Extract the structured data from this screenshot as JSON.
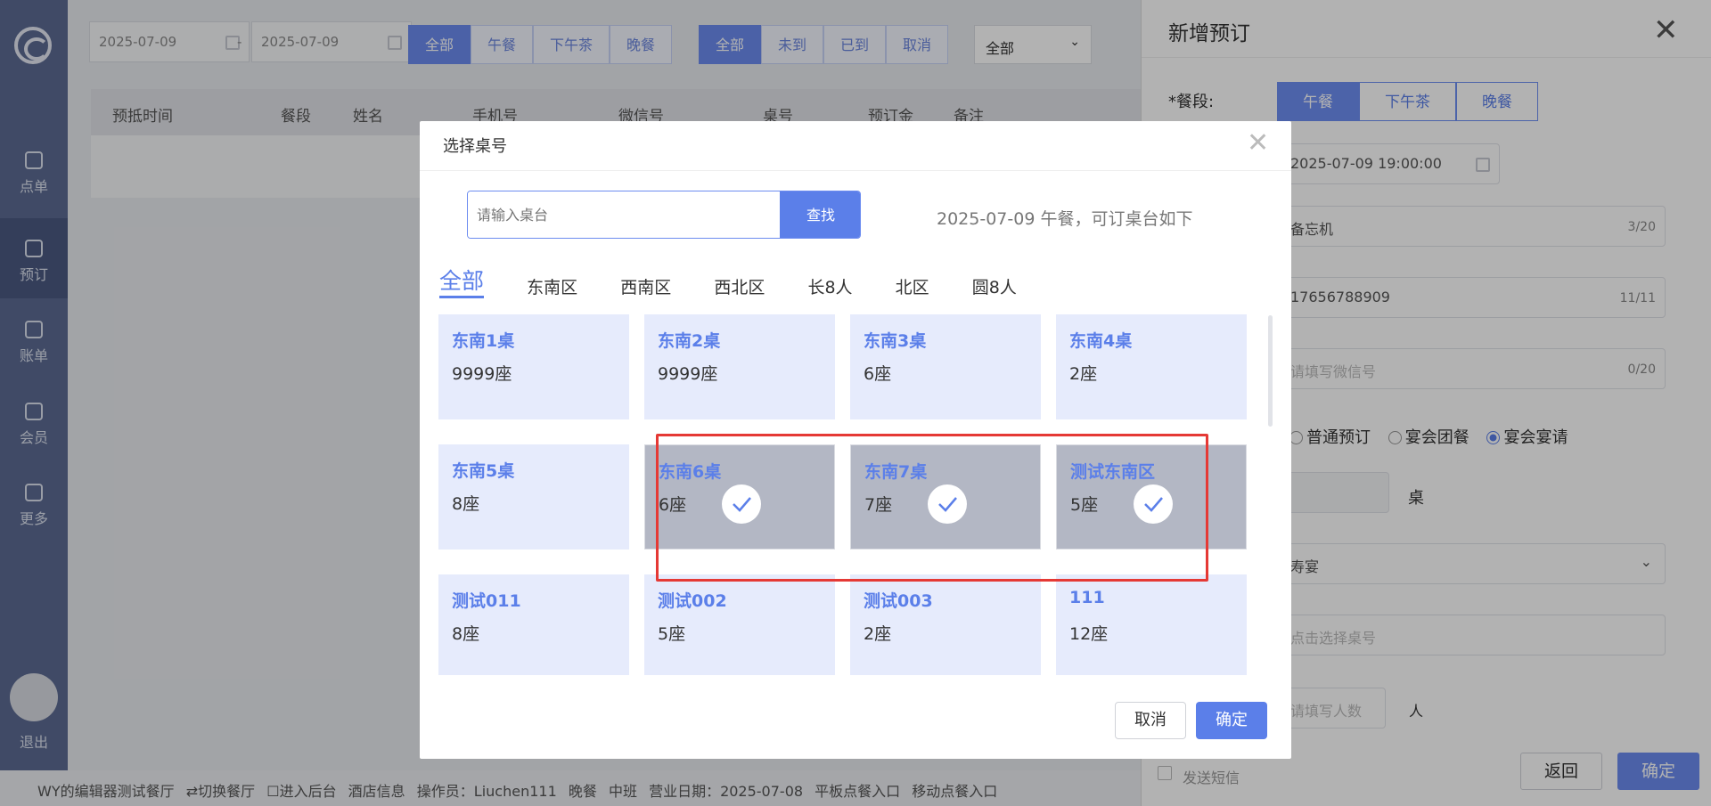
{
  "sidebar": {
    "items": [
      {
        "label": "点单",
        "icon": "chef-hat-icon"
      },
      {
        "label": "预订",
        "icon": "book-icon"
      },
      {
        "label": "账单",
        "icon": "chart-icon"
      },
      {
        "label": "会员",
        "icon": "diamond-icon"
      },
      {
        "label": "更多",
        "icon": "grid-icon"
      }
    ],
    "logout": "退出"
  },
  "filters": {
    "date_start": "2025-07-09",
    "date_sep": "-",
    "date_end": "2025-07-09",
    "meal_segments": [
      "全部",
      "午餐",
      "下午茶",
      "晚餐"
    ],
    "status_segments": [
      "全部",
      "未到",
      "已到",
      "取消"
    ],
    "select_value": "全部"
  },
  "table": {
    "columns": [
      "预抵时间",
      "餐段",
      "姓名",
      "手机号",
      "微信号",
      "桌号",
      "预订金",
      "备注"
    ]
  },
  "footer": {
    "items": [
      "WY的编辑器测试餐厅",
      "⇄切换餐厅",
      "☐进入后台",
      "酒店信息",
      "操作员：Liuchen111",
      "晚餐",
      "中班",
      "营业日期：2025-07-08",
      "平板点餐入口",
      "移动点餐入口"
    ]
  },
  "drawer": {
    "title": "新增预订",
    "close": "✕",
    "meal_label": "*餐段:",
    "meal_options": [
      "午餐",
      "下午茶",
      "晚餐"
    ],
    "datetime": "2025-07-09 19:00:00",
    "name_value": "备忘机",
    "name_count": "3/20",
    "phone_value": "17656788909",
    "phone_count": "11/11",
    "wechat_placeholder": "请填写微信号",
    "wechat_count": "0/20",
    "radio_options": [
      "普通预订",
      "宴会团餐",
      "宴会宴请"
    ],
    "tables_unit": "桌",
    "banquet_type": "寿宴",
    "table_placeholder": "点击选择桌号",
    "people_placeholder": "请填写人数",
    "people_unit": "人",
    "sms_label": "发送短信",
    "return_btn": "返回",
    "confirm_btn": "确定"
  },
  "modal": {
    "title": "选择桌号",
    "close": "✕",
    "search_placeholder": "请输入桌台",
    "search_btn": "查找",
    "avail_text": "2025-07-09  午餐，可订桌台如下",
    "tabs": [
      "全部",
      "东南区",
      "西南区",
      "西北区",
      "长8人",
      "北区",
      "圆8人"
    ],
    "cards": [
      {
        "name": "东南1桌",
        "seats": "9999座",
        "selected": false
      },
      {
        "name": "东南2桌",
        "seats": "9999座",
        "selected": false
      },
      {
        "name": "东南3桌",
        "seats": "6座",
        "selected": false
      },
      {
        "name": "东南4桌",
        "seats": "2座",
        "selected": false
      },
      {
        "name": "东南5桌",
        "seats": "8座",
        "selected": false
      },
      {
        "name": "东南6桌",
        "seats": "6座",
        "selected": true
      },
      {
        "name": "东南7桌",
        "seats": "7座",
        "selected": true
      },
      {
        "name": "测试东南区",
        "seats": "5座",
        "selected": true
      },
      {
        "name": "测试011",
        "seats": "8座",
        "selected": false
      },
      {
        "name": "测试002",
        "seats": "5座",
        "selected": false
      },
      {
        "name": "测试003",
        "seats": "2座",
        "selected": false
      },
      {
        "name": "111",
        "seats": "12座",
        "selected": false
      }
    ],
    "cancel_btn": "取消",
    "ok_btn": "确定"
  },
  "colors": {
    "accent": "#5b7fe9",
    "sidebar": "#5c6b93",
    "selected_card": "#b3b7c4",
    "card": "#e6ebfc",
    "highlight": "#e53935"
  }
}
